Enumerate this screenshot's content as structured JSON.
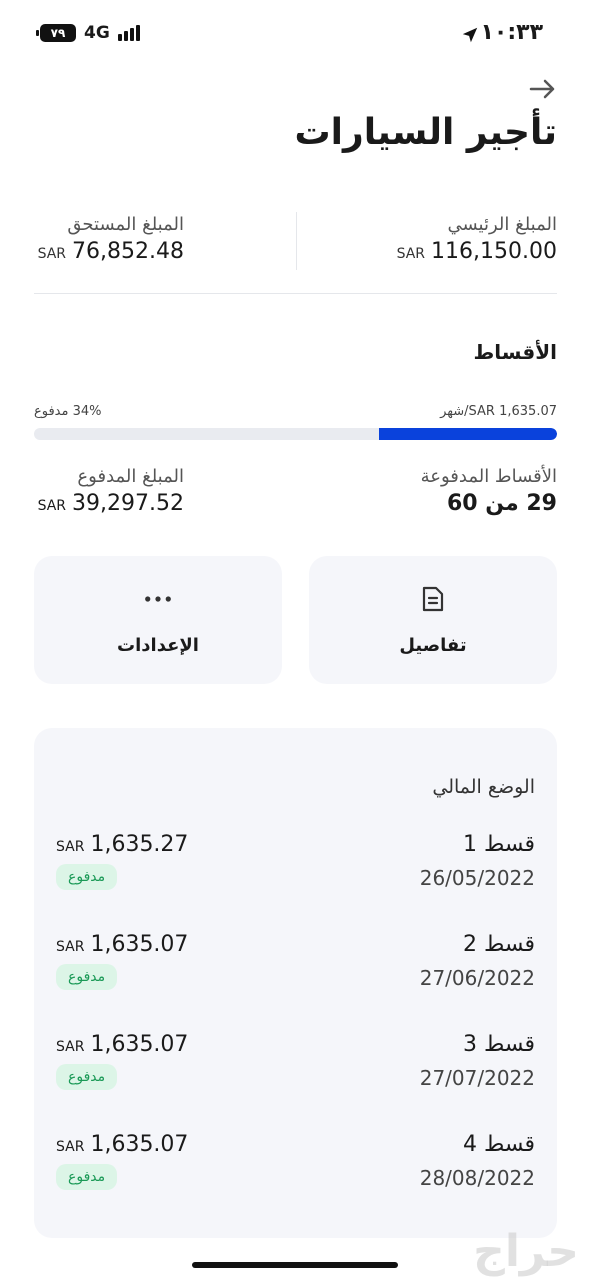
{
  "status_bar": {
    "battery": "٧٩",
    "network": "4G",
    "time": "١٠:٣٣"
  },
  "header": {
    "title": "تأجير السيارات"
  },
  "summary": {
    "principal_label": "المبلغ الرئيسي",
    "principal_currency": "SAR",
    "principal_value": "116,150.00",
    "due_label": "المبلغ المستحق",
    "due_currency": "SAR",
    "due_value": "76,852.48"
  },
  "installments": {
    "title": "الأقساط",
    "monthly_text": "SAR 1,635.07/شهر",
    "paid_percent_text": "34% مدفوع",
    "paid_fraction": 0.34,
    "paid_count_label": "الأقساط المدفوعة",
    "paid_count_value": "29 من 60",
    "paid_amount_label": "المبلغ المدفوع",
    "paid_amount_currency": "SAR",
    "paid_amount_value": "39,297.52"
  },
  "actions": {
    "details_label": "تفاصيل",
    "settings_label": "الإعدادات"
  },
  "financial": {
    "title": "الوضع المالي",
    "rows": [
      {
        "name": "قسط 1",
        "date": "26/05/2022",
        "currency": "SAR",
        "amount": "1,635.27",
        "status": "مدفوع"
      },
      {
        "name": "قسط 2",
        "date": "27/06/2022",
        "currency": "SAR",
        "amount": "1,635.07",
        "status": "مدفوع"
      },
      {
        "name": "قسط 3",
        "date": "27/07/2022",
        "currency": "SAR",
        "amount": "1,635.07",
        "status": "مدفوع"
      },
      {
        "name": "قسط 4",
        "date": "28/08/2022",
        "currency": "SAR",
        "amount": "1,635.07",
        "status": "مدفوع"
      }
    ]
  },
  "watermark": "حراج",
  "colors": {
    "accent": "#0a42dc",
    "paid_badge_bg": "#dcf5e7",
    "paid_badge_text": "#1b9a57",
    "card_bg": "#f5f6fa"
  }
}
